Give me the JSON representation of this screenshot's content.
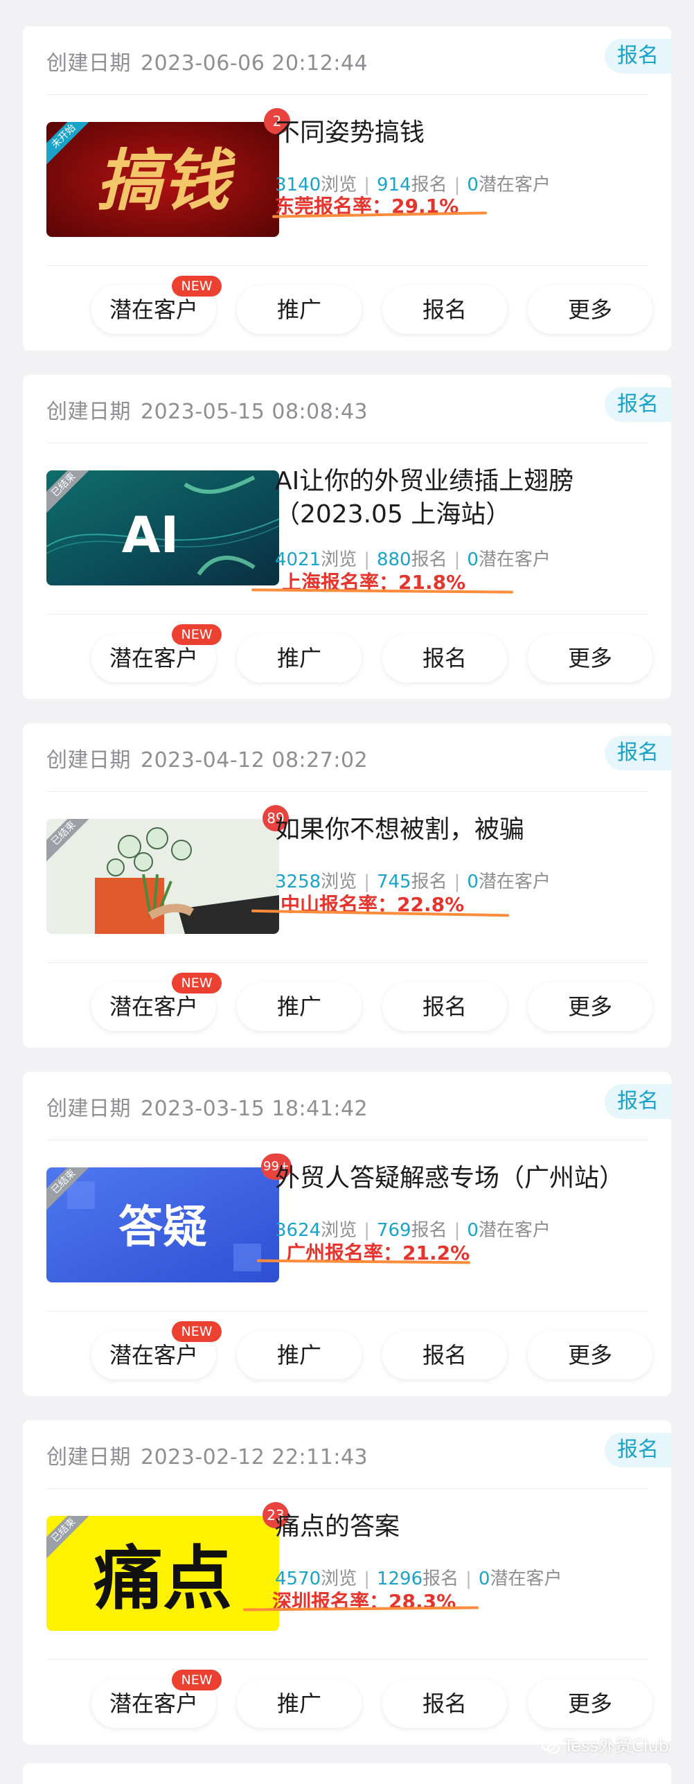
{
  "cards": [
    {
      "created_label": "创建日期",
      "created_at": "2023-06-06 20:12:44",
      "tag": "报名",
      "badge": "2",
      "ribbon": "未开始",
      "thumb_text": "搞钱",
      "title": "不同姿势搞钱",
      "views": "3140",
      "views_label": "浏览",
      "signups": "914",
      "signups_label": "报名",
      "leads": "0",
      "leads_label": "潜在客户",
      "rate": "东莞报名率：29.1%",
      "buttons": [
        "潜在客户",
        "推广",
        "报名",
        "更多"
      ],
      "new_label": "NEW"
    },
    {
      "created_label": "创建日期",
      "created_at": "2023-05-15 08:08:43",
      "tag": "报名",
      "badge": "",
      "ribbon": "已结束",
      "thumb_text": "AI",
      "title": "AI让你的外贸业绩插上翅膀（2023.05 上海站）",
      "views": "4021",
      "views_label": "浏览",
      "signups": "880",
      "signups_label": "报名",
      "leads": "0",
      "leads_label": "潜在客户",
      "rate": "上海报名率：21.8%",
      "buttons": [
        "潜在客户",
        "推广",
        "报名",
        "更多"
      ],
      "new_label": "NEW"
    },
    {
      "created_label": "创建日期",
      "created_at": "2023-04-12 08:27:02",
      "tag": "报名",
      "badge": "89",
      "ribbon": "已结束",
      "thumb_text": "",
      "title": "如果你不想被割，被骗",
      "views": "3258",
      "views_label": "浏览",
      "signups": "745",
      "signups_label": "报名",
      "leads": "0",
      "leads_label": "潜在客户",
      "rate": "中山报名率：22.8%",
      "buttons": [
        "潜在客户",
        "推广",
        "报名",
        "更多"
      ],
      "new_label": "NEW"
    },
    {
      "created_label": "创建日期",
      "created_at": "2023-03-15 18:41:42",
      "tag": "报名",
      "badge": "99+",
      "ribbon": "已结束",
      "thumb_text": "答疑",
      "title": "外贸人答疑解惑专场（广州站）",
      "views": "3624",
      "views_label": "浏览",
      "signups": "769",
      "signups_label": "报名",
      "leads": "0",
      "leads_label": "潜在客户",
      "rate": "广州报名率：21.2%",
      "buttons": [
        "潜在客户",
        "推广",
        "报名",
        "更多"
      ],
      "new_label": "NEW"
    },
    {
      "created_label": "创建日期",
      "created_at": "2023-02-12 22:11:43",
      "tag": "报名",
      "badge": "23",
      "ribbon": "已结束",
      "thumb_text": "痛点",
      "title": "痛点的答案",
      "views": "4570",
      "views_label": "浏览",
      "signups": "1296",
      "signups_label": "报名",
      "leads": "0",
      "leads_label": "潜在客户",
      "rate": "深圳报名率：28.3%",
      "buttons": [
        "潜在客户",
        "推广",
        "报名",
        "更多"
      ],
      "new_label": "NEW"
    }
  ],
  "watermark": "Tess外贸Club",
  "colors": {
    "accent": "#1aa3c9",
    "rate_red": "#e6332b",
    "underline_orange": "#ff8c3a",
    "badge_red": "#e8433f"
  }
}
